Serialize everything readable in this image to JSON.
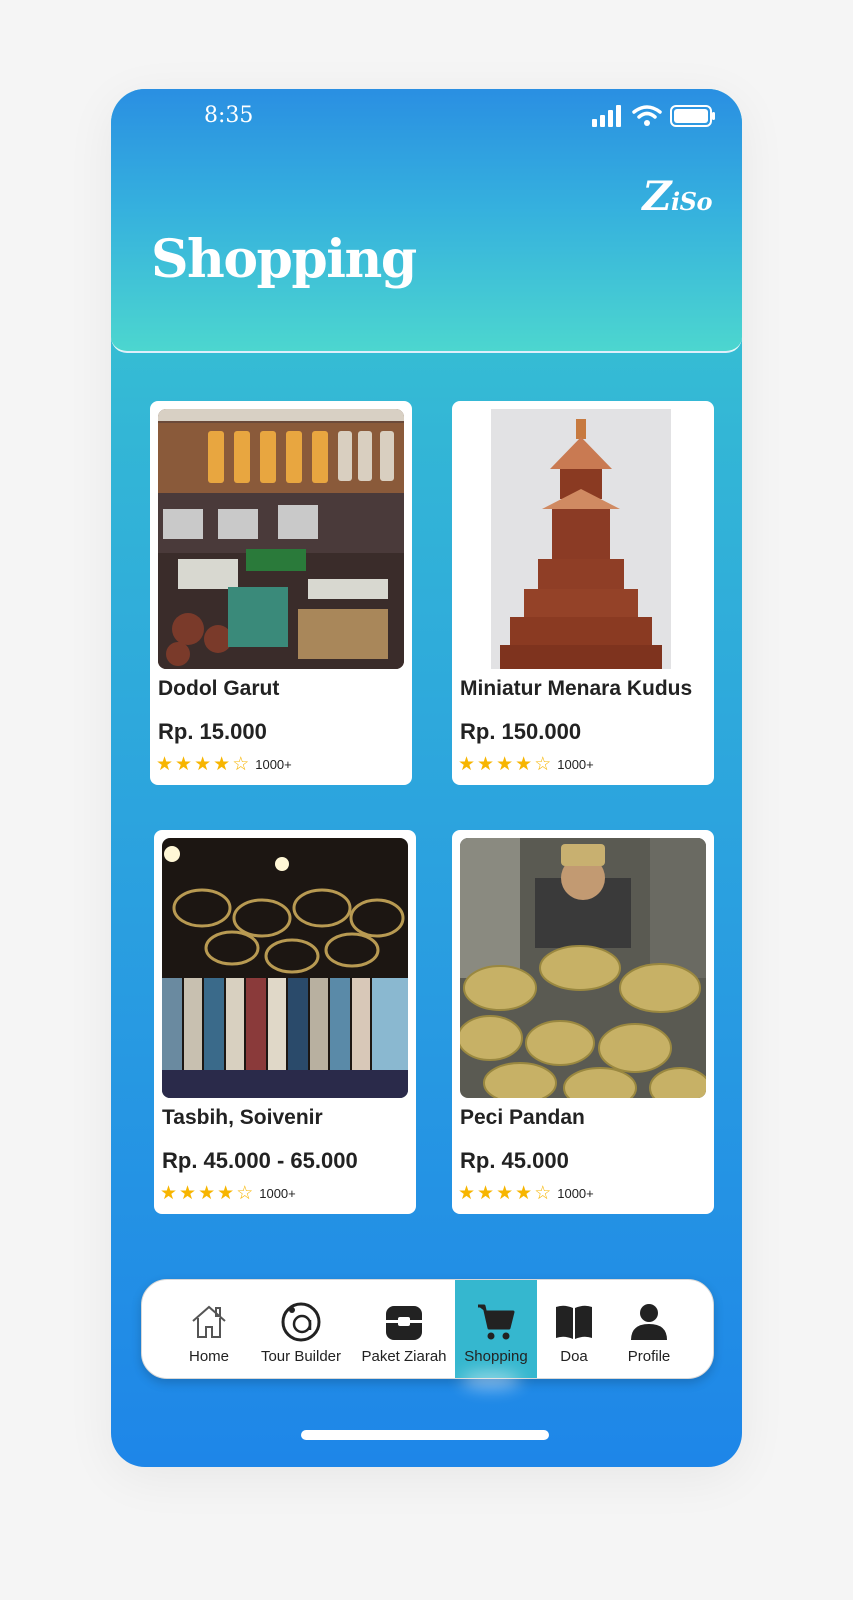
{
  "status": {
    "time": "8:35"
  },
  "brand": {
    "first": "Z",
    "rest": "iSo"
  },
  "page": {
    "title": "Shopping"
  },
  "products": [
    {
      "name": "Dodol Garut",
      "price": "Rp. 15.000",
      "rating": 4,
      "count": "1000+"
    },
    {
      "name": "Miniatur Menara Kudus",
      "price": "Rp. 150.000",
      "rating": 4,
      "count": "1000+"
    },
    {
      "name": "Tasbih, Soivenir",
      "price": "Rp. 45.000 - 65.000",
      "rating": 4,
      "count": "1000+"
    },
    {
      "name": "Peci Pandan",
      "price": "Rp. 45.000",
      "rating": 4,
      "count": "1000+"
    }
  ],
  "nav": {
    "items": [
      {
        "label": "Home",
        "icon": "home-icon"
      },
      {
        "label": "Tour Builder",
        "icon": "at-sign-icon"
      },
      {
        "label": "Paket Ziarah",
        "icon": "package-icon"
      },
      {
        "label": "Shopping",
        "icon": "cart-icon",
        "active": true
      },
      {
        "label": "Doa",
        "icon": "book-icon"
      },
      {
        "label": "Profile",
        "icon": "person-icon"
      }
    ]
  },
  "colors": {
    "accent": "#35b7cf",
    "star": "#f7b500"
  }
}
